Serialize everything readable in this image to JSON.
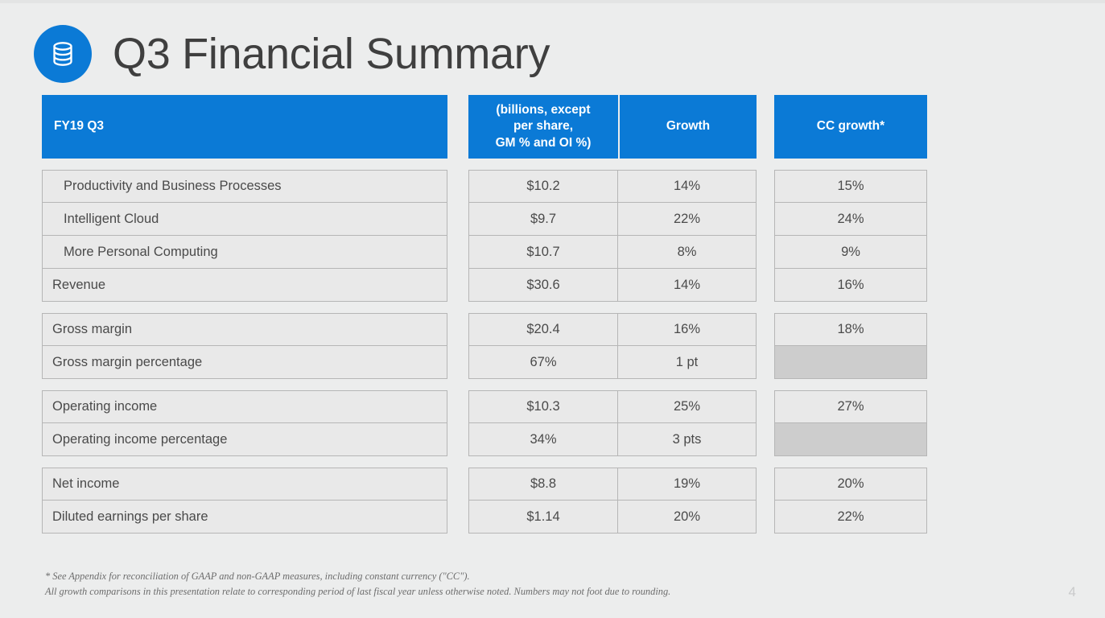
{
  "slide": {
    "title": "Q3 Financial Summary",
    "icon": "database-icon",
    "page_number": "4",
    "accent_color": "#0b7ad6",
    "background_color": "#eceded",
    "cell_color": "#e9e9e9",
    "shaded_cell_color": "#cdcdcd"
  },
  "table": {
    "headers": {
      "label": "FY19 Q3",
      "value": "(billions, except per share, GM % and OI %)",
      "value_lines": [
        "(billions, except",
        "per share,",
        "GM % and OI %)"
      ],
      "growth": "Growth",
      "cc_growth": "CC growth*"
    },
    "blocks": [
      {
        "rows": [
          {
            "label": "Productivity and Business Processes",
            "indent": true,
            "value": "$10.2",
            "growth": "14%",
            "cc_growth": "15%",
            "cc_shaded": false
          },
          {
            "label": "Intelligent Cloud",
            "indent": true,
            "value": "$9.7",
            "growth": "22%",
            "cc_growth": "24%",
            "cc_shaded": false
          },
          {
            "label": "More Personal Computing",
            "indent": true,
            "value": "$10.7",
            "growth": "8%",
            "cc_growth": "9%",
            "cc_shaded": false
          },
          {
            "label": "Revenue",
            "indent": false,
            "value": "$30.6",
            "growth": "14%",
            "cc_growth": "16%",
            "cc_shaded": false
          }
        ]
      },
      {
        "rows": [
          {
            "label": "Gross margin",
            "indent": false,
            "value": "$20.4",
            "growth": "16%",
            "cc_growth": "18%",
            "cc_shaded": false
          },
          {
            "label": "Gross margin percentage",
            "indent": false,
            "value": "67%",
            "growth": "1 pt",
            "cc_growth": "",
            "cc_shaded": true
          }
        ]
      },
      {
        "rows": [
          {
            "label": "Operating income",
            "indent": false,
            "value": "$10.3",
            "growth": "25%",
            "cc_growth": "27%",
            "cc_shaded": false
          },
          {
            "label": "Operating income percentage",
            "indent": false,
            "value": "34%",
            "growth": "3 pts",
            "cc_growth": "",
            "cc_shaded": true
          }
        ]
      },
      {
        "rows": [
          {
            "label": "Net income",
            "indent": false,
            "value": "$8.8",
            "growth": "19%",
            "cc_growth": "20%",
            "cc_shaded": false
          },
          {
            "label": "Diluted earnings per share",
            "indent": false,
            "value": "$1.14",
            "growth": "20%",
            "cc_growth": "22%",
            "cc_shaded": false
          }
        ]
      }
    ]
  },
  "footnotes": [
    "* See Appendix for reconciliation of GAAP and non-GAAP measures, including constant currency (\"CC\").",
    "All growth comparisons in this presentation relate to corresponding period of last fiscal year unless otherwise noted. Numbers may not foot due to rounding."
  ]
}
